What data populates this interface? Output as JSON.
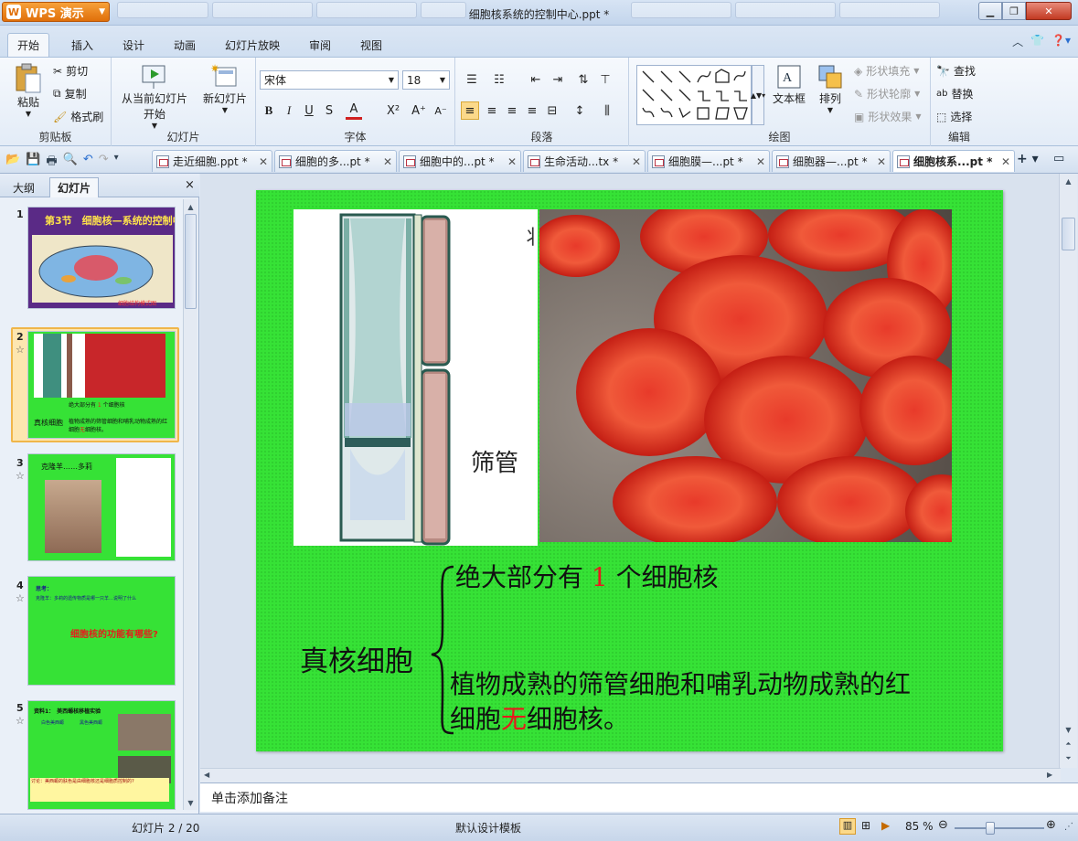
{
  "app": {
    "name": "WPS 演示",
    "window_title": "细胞核系统的控制中心.ppt *"
  },
  "menu_tabs": [
    "开始",
    "插入",
    "设计",
    "动画",
    "幻灯片放映",
    "审阅",
    "视图"
  ],
  "clipboard": {
    "paste": "粘贴",
    "cut": "剪切",
    "copy": "复制",
    "format_painter": "格式刷",
    "group": "剪贴板"
  },
  "slides_group": {
    "from_current": "从当前幻灯片",
    "from_current_2": "开始",
    "new_slide": "新幻灯片",
    "group": "幻灯片"
  },
  "font": {
    "name": "宋体",
    "size": "18",
    "bold": "B",
    "italic": "I",
    "underline": "U",
    "shadow": "S",
    "color": "A",
    "group": "字体"
  },
  "paragraph": {
    "group": "段落"
  },
  "drawing": {
    "textbox": "文本框",
    "arrange": "排列",
    "shape_fill": "形状填充",
    "shape_outline": "形状轮廓",
    "shape_effect": "形状效果",
    "group": "绘图"
  },
  "editing": {
    "find": "查找",
    "replace": "替换",
    "select": "选择",
    "group": "编辑"
  },
  "doc_tabs": [
    "走近细胞.ppt *",
    "细胞的多...pt *",
    "细胞中的...pt *",
    "生命活动...tx *",
    "细胞膜—...pt *",
    "细胞器—...pt *",
    "细胞核系...pt *"
  ],
  "left_panel": {
    "tab_outline": "大纲",
    "tab_slides": "幻灯片",
    "close": "×",
    "thumbs": [
      {
        "num": "1",
        "title": "第3节　细胞核—系统的控制中心",
        "caption": "细胞结构模式图"
      },
      {
        "num": "2"
      },
      {
        "num": "3",
        "title": "克隆羊……多莉"
      },
      {
        "num": "4",
        "q1": "思考：",
        "q2": "克隆羊：多莉的遗传物质是哪一只羊…说明了什么",
        "big": "细胞核的功能有哪些?"
      },
      {
        "num": "5",
        "title": "资料1：　美西螈核移植实验",
        "sub1": "白色美西螈",
        "sub2": "黑色美西螈",
        "note": "讨论：美西螈的肤色是由细胞核还是细胞质控制的?"
      }
    ]
  },
  "slide": {
    "label_sieve": "筛管",
    "left_term": "真核细胞",
    "line1_a": "绝大部分有 ",
    "line1_num": "1",
    "line1_b": " 个细胞核",
    "line2_a": "植物成熟的筛管细胞和哺乳动物成熟的红",
    "line2_b": "细胞",
    "line2_red": "无",
    "line2_c": "细胞核。"
  },
  "notes_placeholder": "单击添加备注",
  "status": {
    "slide_counter": "幻灯片 2 / 20",
    "template": "默认设计模板",
    "zoom": "85 %"
  },
  "colors": {
    "accent_red": "#e8191c",
    "slide_green": "#36e236",
    "wps_orange": "#e98521"
  }
}
